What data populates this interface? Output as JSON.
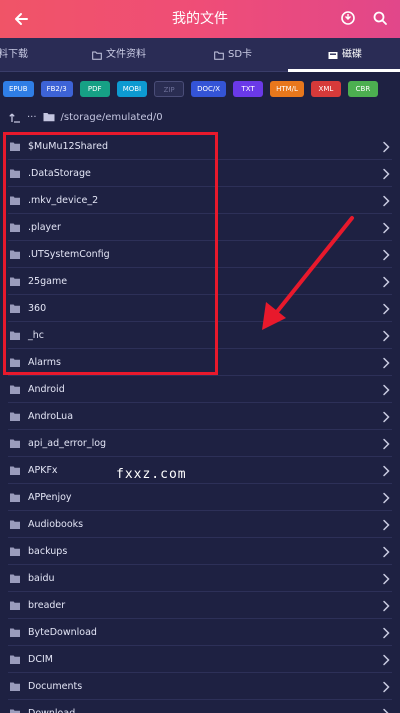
{
  "header": {
    "title": "我的文件",
    "back_icon": "arrow-left-icon",
    "action_icons": [
      "clean-icon",
      "search-icon"
    ]
  },
  "tabs": [
    {
      "label": "料下载",
      "icon": ""
    },
    {
      "label": "文件资料",
      "icon": "folder-outline-icon"
    },
    {
      "label": "SD卡",
      "icon": "folder-outline-icon"
    },
    {
      "label": "磁碟",
      "icon": "disk-icon",
      "active": true
    }
  ],
  "chips": [
    {
      "label": "EPUB",
      "color": "#2f7ee6"
    },
    {
      "label": "FB2/3",
      "color": "#3d63d6"
    },
    {
      "label": "PDF",
      "color": "#16a085"
    },
    {
      "label": "MOBI",
      "color": "#0d9ad1"
    },
    {
      "label": "ZIP",
      "color": "#2a2d52"
    },
    {
      "label": "DOC/X",
      "color": "#3454d6"
    },
    {
      "label": "TXT",
      "color": "#6a39e8"
    },
    {
      "label": "HTM/L",
      "color": "#e8771c"
    },
    {
      "label": "XML",
      "color": "#d63a3a"
    },
    {
      "label": "CBR",
      "color": "#4caf50"
    }
  ],
  "path": {
    "text": "/storage/emulated/0",
    "ellipsis": "···"
  },
  "folders": [
    "$MuMu12Shared",
    ".DataStorage",
    ".mkv_device_2",
    ".player",
    ".UTSystemConfig",
    "25game",
    "360",
    "_hc",
    "Alarms",
    "Android",
    "AndroLua",
    "api_ad_error_log",
    "APKFx",
    "APPenjoy",
    "Audiobooks",
    "backups",
    "baidu",
    "breader",
    "ByteDownload",
    "DCIM",
    "Documents",
    "Download"
  ],
  "watermark": "fxxz.com"
}
